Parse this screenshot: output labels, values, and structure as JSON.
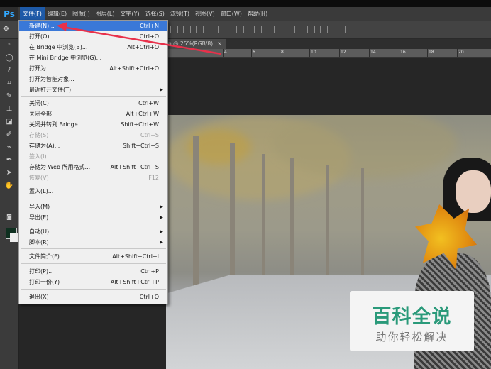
{
  "app": {
    "logo": "Ps"
  },
  "menubar": {
    "items": [
      {
        "label": "文件(F)",
        "active": true
      },
      {
        "label": "编辑(E)"
      },
      {
        "label": "图像(I)"
      },
      {
        "label": "图层(L)"
      },
      {
        "label": "文字(Y)"
      },
      {
        "label": "选择(S)"
      },
      {
        "label": "滤镜(T)"
      },
      {
        "label": "视图(V)"
      },
      {
        "label": "窗口(W)"
      },
      {
        "label": "帮助(H)"
      }
    ]
  },
  "document_tab": {
    "label": "n @ 25%(RGB/8)",
    "close": "×"
  },
  "ruler": {
    "ticks": [
      "4",
      "6",
      "8",
      "10",
      "12",
      "14",
      "16",
      "18",
      "20"
    ]
  },
  "file_menu": {
    "items": [
      {
        "label": "新建(N)...",
        "shortcut": "Ctrl+N",
        "highlighted": true
      },
      {
        "label": "打开(O)...",
        "shortcut": "Ctrl+O"
      },
      {
        "label": "在 Bridge 中浏览(B)...",
        "shortcut": "Alt+Ctrl+O"
      },
      {
        "label": "在 Mini Bridge 中浏览(G)...",
        "shortcut": ""
      },
      {
        "label": "打开为...",
        "shortcut": "Alt+Shift+Ctrl+O"
      },
      {
        "label": "打开为智能对象...",
        "shortcut": ""
      },
      {
        "label": "最近打开文件(T)",
        "shortcut": "",
        "submenu": true
      },
      {
        "label": "关闭(C)",
        "shortcut": "Ctrl+W"
      },
      {
        "label": "关闭全部",
        "shortcut": "Alt+Ctrl+W"
      },
      {
        "label": "关闭并转到 Bridge...",
        "shortcut": "Shift+Ctrl+W"
      },
      {
        "label": "存储(S)",
        "shortcut": "Ctrl+S",
        "disabled": true
      },
      {
        "label": "存储为(A)...",
        "shortcut": "Shift+Ctrl+S"
      },
      {
        "label": "签入(I)...",
        "shortcut": "",
        "disabled": true
      },
      {
        "label": "存储为 Web 所用格式...",
        "shortcut": "Alt+Shift+Ctrl+S"
      },
      {
        "label": "恢复(V)",
        "shortcut": "F12",
        "disabled": true
      },
      {
        "label": "置入(L)...",
        "shortcut": ""
      },
      {
        "label": "导入(M)",
        "shortcut": "",
        "submenu": true
      },
      {
        "label": "导出(E)",
        "shortcut": "",
        "submenu": true
      },
      {
        "label": "自动(U)",
        "shortcut": "",
        "submenu": true
      },
      {
        "label": "脚本(R)",
        "shortcut": "",
        "submenu": true
      },
      {
        "label": "文件简介(F)...",
        "shortcut": "Alt+Shift+Ctrl+I"
      },
      {
        "label": "打印(P)...",
        "shortcut": "Ctrl+P"
      },
      {
        "label": "打印一份(Y)",
        "shortcut": "Alt+Shift+Ctrl+P"
      },
      {
        "label": "退出(X)",
        "shortcut": "Ctrl+Q"
      }
    ]
  },
  "watermark": {
    "title": "百科全说",
    "subtitle": "助你轻松解决"
  },
  "colors": {
    "accent": "#1e5aa8",
    "highlight": "#3a78d8",
    "arrow": "#e8304a",
    "watermark": "#2a9a7a"
  },
  "icons": [
    "move-icon",
    "marquee-icon",
    "lasso-icon",
    "crop-icon",
    "eyedropper-icon",
    "healing-brush-icon",
    "brush-icon",
    "stamp-icon",
    "history-brush-icon",
    "eraser-icon",
    "gradient-icon",
    "pen-icon",
    "selection-icon",
    "hand-icon",
    "zoom-icon"
  ]
}
